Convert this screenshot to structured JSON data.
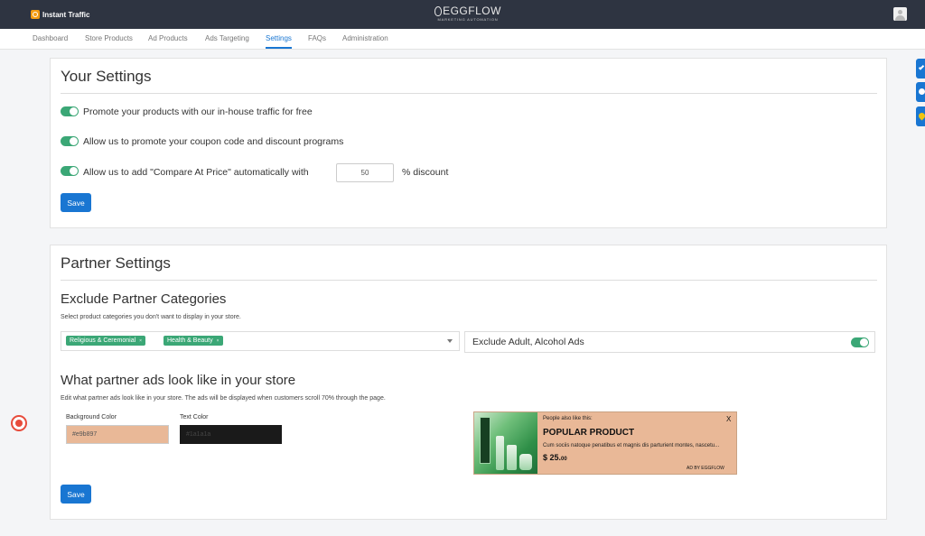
{
  "app": {
    "name": "Instant Traffic"
  },
  "logo": {
    "main": "EGGFLOW",
    "tagline": "MARKETING AUTOMATION"
  },
  "nav": {
    "items": [
      {
        "label": "Dashboard"
      },
      {
        "label": "Store Products"
      },
      {
        "label": "Ad Products"
      },
      {
        "label": "Ads Targeting"
      },
      {
        "label": "Settings",
        "active": true
      },
      {
        "label": "FAQs"
      },
      {
        "label": "Administration"
      }
    ]
  },
  "your_settings": {
    "title": "Your Settings",
    "options": [
      {
        "label": "Promote your products with our in-house traffic for free",
        "enabled": true
      },
      {
        "label": "Allow us to promote your coupon code and discount programs",
        "enabled": true
      },
      {
        "label": "Allow us to add \"Compare At Price\" automatically with",
        "enabled": true
      }
    ],
    "discount_value": "50",
    "discount_suffix": "% discount",
    "save_label": "Save"
  },
  "partner_settings": {
    "title": "Partner Settings",
    "exclude": {
      "title": "Exclude Partner Categories",
      "help": "Select product categories you don't want to display in your store.",
      "selected": [
        "Religious & Ceremonial",
        "Health & Beauty"
      ],
      "chip_remove": "×",
      "adult_label": "Exclude Adult, Alcohol Ads",
      "adult_enabled": true
    },
    "look": {
      "title": "What partner ads look like in your store",
      "help": "Edit what partner ads look like in your store. The ads will be displayed when customers scroll 70% through the page.",
      "bg_label": "Background Color",
      "bg_value": "#e9b897",
      "text_label": "Text Color",
      "text_value": "#1a1a1a"
    },
    "preview": {
      "people_also": "People also like this:",
      "close": "X",
      "product_title": "POPULAR PRODUCT",
      "description": "Cum sociis natoque penatibus et magnis dis parturient montes, nascetu...",
      "price_main": "$ 25.",
      "price_cents": "00",
      "byline": "AD BY EGGFLOW"
    },
    "save_label": "Save"
  },
  "colors": {
    "accent": "#1976d2",
    "toggle_on": "#3ba776",
    "topbar": "#2e3441",
    "ad_background": "#e9b897",
    "ad_text": "#1a1a1a"
  }
}
